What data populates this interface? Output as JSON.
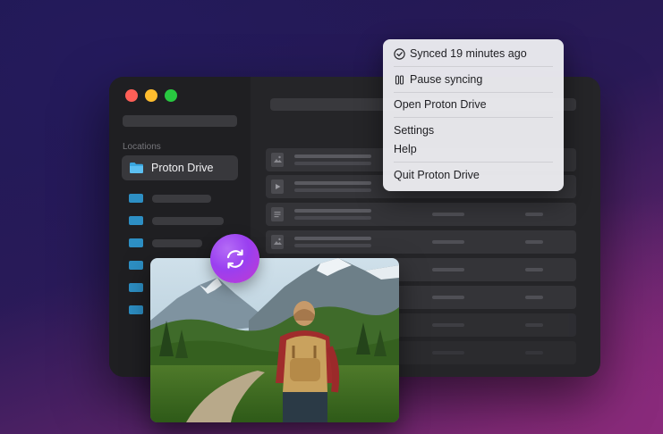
{
  "sidebar": {
    "locations_label": "Locations",
    "location_item": {
      "label": "Proton Drive",
      "icon": "folder-icon"
    },
    "placeholder_rows": 6
  },
  "menu": {
    "items": [
      {
        "label": "Synced 19 minutes ago",
        "icon": "check-circle-icon"
      },
      {
        "label": "Pause syncing",
        "icon": "pause-icon"
      },
      {
        "label": "Open Proton Drive"
      },
      {
        "label": "Settings"
      },
      {
        "label": "Help"
      },
      {
        "label": "Quit Proton Drive"
      }
    ]
  },
  "colors": {
    "accent": "#2d8fc4",
    "traffic_red": "#ff5f57",
    "traffic_yellow": "#febc2e",
    "traffic_green": "#28c840",
    "sync_badge": "#9a3ff0"
  },
  "badge": {
    "icon": "sync-icon"
  }
}
